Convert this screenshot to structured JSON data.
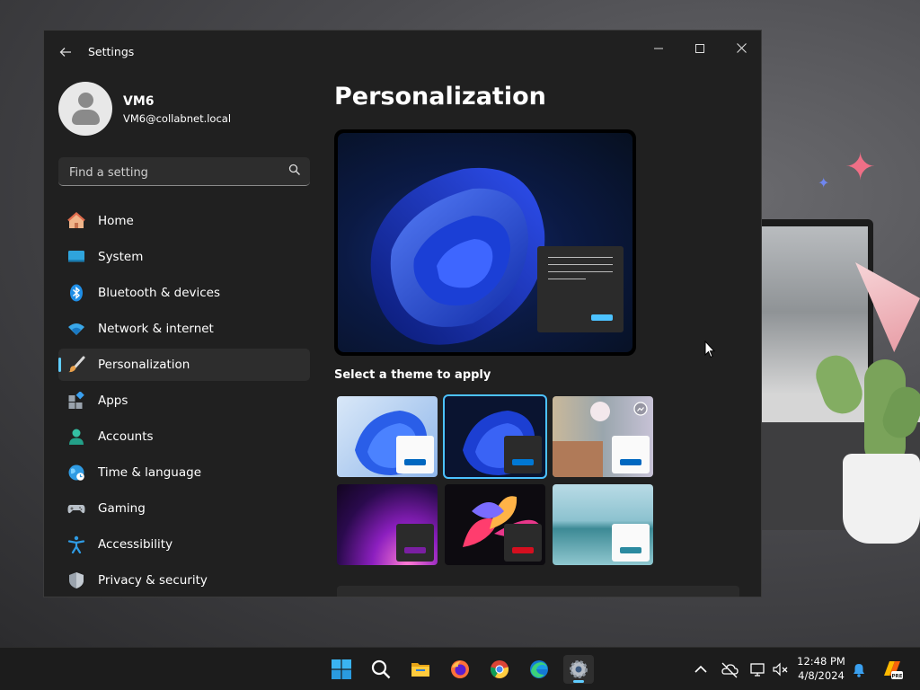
{
  "window": {
    "title": "Settings",
    "controls": {
      "minimize": "—",
      "maximize": "☐",
      "close": "✕"
    }
  },
  "user": {
    "name": "VM6",
    "email": "VM6@collabnet.local"
  },
  "search": {
    "placeholder": "Find a setting"
  },
  "nav": {
    "items": [
      {
        "label": "Home",
        "icon": "home-icon"
      },
      {
        "label": "System",
        "icon": "system-icon"
      },
      {
        "label": "Bluetooth & devices",
        "icon": "bluetooth-icon"
      },
      {
        "label": "Network & internet",
        "icon": "wifi-icon"
      },
      {
        "label": "Personalization",
        "icon": "brush-icon",
        "selected": true
      },
      {
        "label": "Apps",
        "icon": "apps-icon"
      },
      {
        "label": "Accounts",
        "icon": "person-icon"
      },
      {
        "label": "Time & language",
        "icon": "globe-icon"
      },
      {
        "label": "Gaming",
        "icon": "controller-icon"
      },
      {
        "label": "Accessibility",
        "icon": "accessibility-icon"
      },
      {
        "label": "Privacy & security",
        "icon": "shield-icon"
      }
    ]
  },
  "main": {
    "title": "Personalization",
    "theme_section_label": "Select a theme to apply",
    "themes": [
      {
        "name": "windows-light",
        "selected": false,
        "accent": "#0067c0"
      },
      {
        "name": "windows-dark",
        "selected": true,
        "accent": "#0078d4"
      },
      {
        "name": "windows-spotlight",
        "selected": false,
        "accent": "#0067c0"
      },
      {
        "name": "glow",
        "selected": false,
        "accent": "#7a1fa2"
      },
      {
        "name": "captured-motion",
        "selected": false,
        "accent": "#d40f1f"
      },
      {
        "name": "flow",
        "selected": false,
        "accent": "#2b8aa0"
      }
    ]
  },
  "taskbar": {
    "apps": [
      "start-icon",
      "search-icon",
      "file-explorer-icon",
      "firefox-icon",
      "chrome-icon",
      "edge-icon",
      "settings-icon"
    ],
    "active_app": "settings-icon",
    "tray": [
      "chevron-up-icon",
      "onedrive-icon",
      "network-icon",
      "volume-icon",
      "notification-icon",
      "copilot-icon"
    ],
    "time": "12:48 PM",
    "date": "4/8/2024"
  },
  "colors": {
    "accent": "#60cdff",
    "window_bg": "#202020",
    "selected_bg": "#2d2d2d",
    "taskbar_bg": "#1c1c1c"
  }
}
